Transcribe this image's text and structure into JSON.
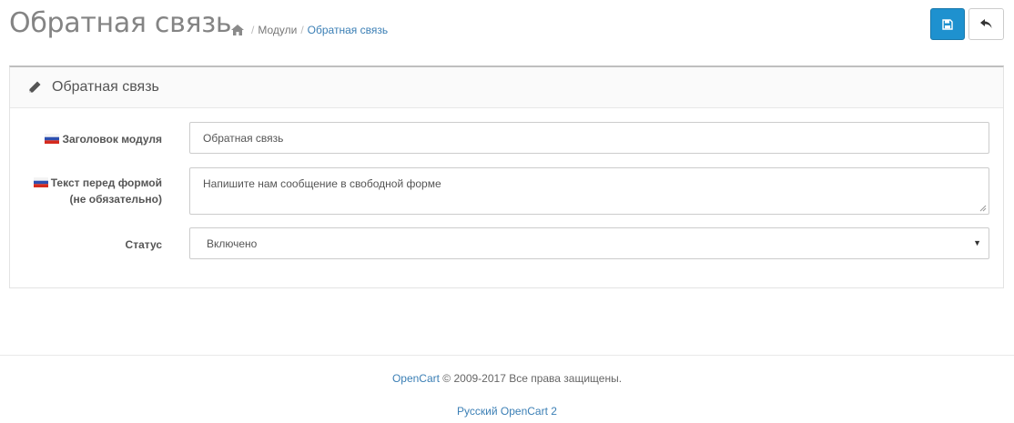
{
  "header": {
    "title": "Обратная связь",
    "breadcrumb": {
      "modules": "Модули",
      "current": "Обратная связь"
    }
  },
  "panel": {
    "title": "Обратная связь"
  },
  "form": {
    "heading_label": "Заголовок модуля",
    "heading_value": "Обратная связь",
    "text_label_line1": "Текст перед формой",
    "text_label_line2": "(не обязательно)",
    "text_value": "Напишите нам сообщение в свободной форме",
    "status_label": "Статус",
    "status_value": "Включено"
  },
  "footer": {
    "brand_link": "OpenCart",
    "copyright": " © 2009-2017 Все права защищены.",
    "version_link": "Русский OpenCart 2"
  },
  "colors": {
    "primary": "#1e91cf",
    "link": "#3b7fb5"
  }
}
